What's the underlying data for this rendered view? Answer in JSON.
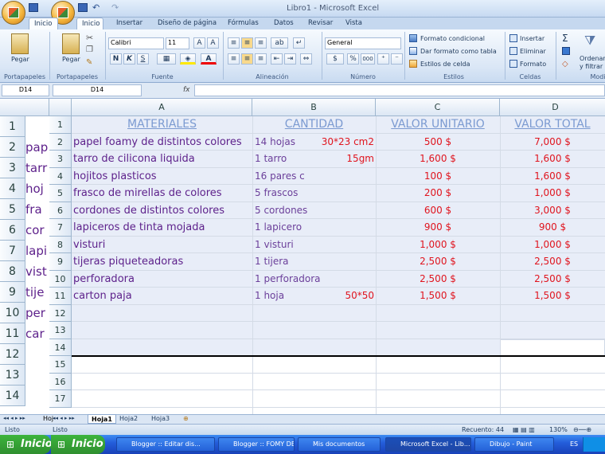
{
  "window": {
    "title": "Libro1 - Microsoft Excel"
  },
  "tabs": [
    "Inicio",
    "Inicio",
    "Insertar",
    "Diseño de página",
    "Fórmulas",
    "Datos",
    "Revisar",
    "Vista"
  ],
  "ribbon": {
    "paste": "Pegar",
    "paste2": "Pegar",
    "font_name": "Calibri",
    "font_size": "11",
    "number_format": "General",
    "cond_format": "Formato condicional",
    "table_format": "Dar formato como tabla",
    "cell_styles": "Estilos de celda",
    "insert": "Insertar",
    "delete": "Eliminar",
    "format": "Formato",
    "sort": "Ordenar",
    "filter": "y filtrar",
    "groups": {
      "clipboard": "Portapapeles",
      "clipboard2": "Portapapeles",
      "font": "Fuente",
      "alignment": "Alineación",
      "number": "Número",
      "styles": "Estilos",
      "cells": "Celdas",
      "editing": "Modi"
    },
    "sigma": "Σ",
    "bold": "N",
    "italic": "K",
    "underline": "S",
    "currency": "$",
    "percent": "%",
    "thousands": "000"
  },
  "formula_bar": {
    "namebox_back": "D14",
    "namebox": "D14",
    "fx": "fx"
  },
  "columns": [
    "A",
    "B",
    "C",
    "D"
  ],
  "back_rows": [
    "1",
    "2",
    "3",
    "4",
    "5",
    "6",
    "7",
    "8",
    "9",
    "10",
    "11",
    "12",
    "13",
    "14"
  ],
  "back_cells": [
    "",
    "pap",
    "tarr",
    "hoj",
    "fra",
    "cor",
    "lapi",
    "vist",
    "tije",
    "per",
    "car"
  ],
  "rows": [
    "1",
    "2",
    "3",
    "4",
    "5",
    "6",
    "7",
    "8",
    "9",
    "10",
    "11",
    "12",
    "13",
    "14",
    "15",
    "16",
    "17"
  ],
  "headers": {
    "a": "MATERIALES",
    "b": "CANTIDAD",
    "c": "VALOR UNITARIO",
    "d": "VALOR TOTAL"
  },
  "data": [
    {
      "a": "papel foamy de distintos colores",
      "b": "14 hojas",
      "b2": "30*23 cm2",
      "c": "500 $",
      "d": "7,000 $"
    },
    {
      "a": "tarro de cilicona liquida",
      "b": "1 tarro",
      "b2": "15gm",
      "c": "1,600 $",
      "d": "1,600 $"
    },
    {
      "a": "hojitos plasticos",
      "b": "16 pares c",
      "b2": "",
      "c": "100 $",
      "d": "1,600 $"
    },
    {
      "a": "frasco de mirellas de colores",
      "b": "5 frascos",
      "b2": "",
      "c": "200 $",
      "d": "1,000 $"
    },
    {
      "a": "cordones de distintos colores",
      "b": "5 cordones",
      "b2": "",
      "c": "600 $",
      "d": "3,000 $"
    },
    {
      "a": "lapiceros de tinta mojada",
      "b": "1 lapicero",
      "b2": "",
      "c": "900 $",
      "d": "900 $"
    },
    {
      "a": "visturi",
      "b": "1 visturi",
      "b2": "",
      "c": "1,000 $",
      "d": "1,000 $"
    },
    {
      "a": "tijeras piqueteadoras",
      "b": "1 tijera",
      "b2": "",
      "c": "2,500 $",
      "d": "2,500 $"
    },
    {
      "a": "perforadora",
      "b": "1 perforadora",
      "b2": "",
      "c": "2,500 $",
      "d": "2,500 $"
    },
    {
      "a": "carton paja",
      "b": "1 hoja",
      "b2": "50*50",
      "c": "1,500 $",
      "d": "1,500 $"
    }
  ],
  "sheets": {
    "back_tab": "Hoj",
    "tab1": "Hoja1",
    "tab2": "Hoja2",
    "tab3": "Hoja3"
  },
  "status": {
    "ready_back": "Listo",
    "ready": "Listo",
    "count": "Recuento: 44",
    "zoom": "130%"
  },
  "taskbar": {
    "start_back": "Inicio",
    "start": "Inicio",
    "items": [
      "Blogger :: Editar dis...",
      "Blogger :: FOMY DE...",
      "Mis documentos",
      "Microsoft Excel - Lib...",
      "Dibujo - Paint"
    ],
    "lang": "ES"
  }
}
